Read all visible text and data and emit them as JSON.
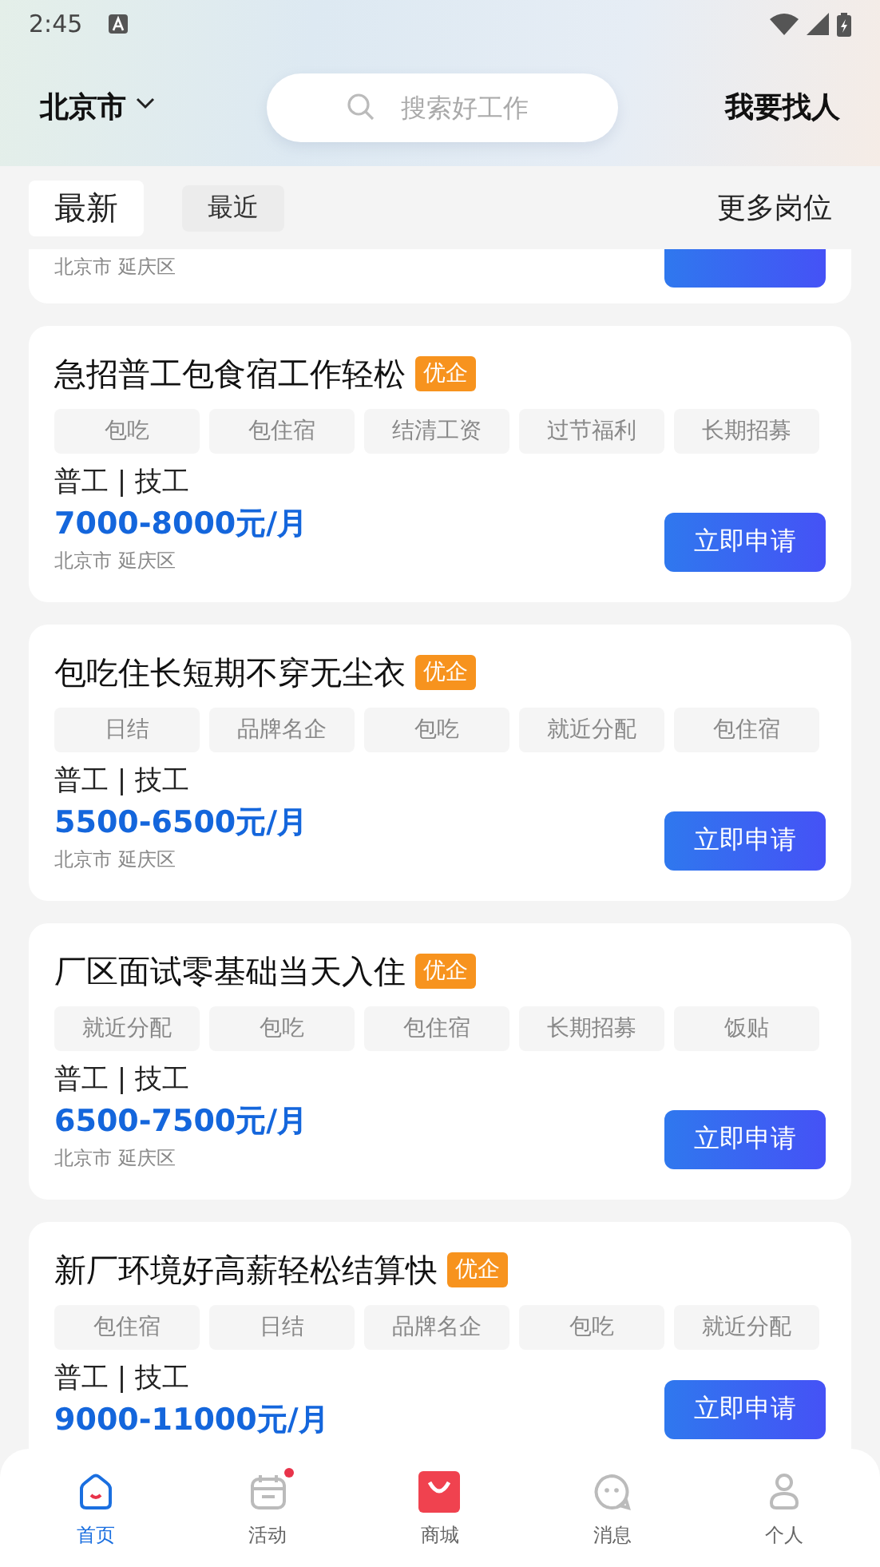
{
  "status_bar": {
    "time": "2:45"
  },
  "header": {
    "city": "北京市",
    "search": {
      "placeholder": "搜索好工作"
    },
    "action": "我要找人"
  },
  "tabs": [
    {
      "label": "最新",
      "selected": true
    },
    {
      "label": "最近",
      "selected": false
    }
  ],
  "more_link": "更多岗位",
  "partial_card": {
    "location": "北京市 延庆区"
  },
  "jobs": [
    {
      "title": "急招普工包食宿工作轻松",
      "badge": "优企",
      "tags": [
        "包吃",
        "包住宿",
        "结清工资",
        "过节福利",
        "长期招募"
      ],
      "category": "普工 | 技工",
      "salary": "7000-8000元/月",
      "location": "北京市 延庆区",
      "button": "立即申请"
    },
    {
      "title": "包吃住长短期不穿无尘衣",
      "badge": "优企",
      "tags": [
        "日结",
        "品牌名企",
        "包吃",
        "就近分配",
        "包住宿"
      ],
      "category": "普工 | 技工",
      "salary": "5500-6500元/月",
      "location": "北京市 延庆区",
      "button": "立即申请"
    },
    {
      "title": "厂区面试零基础当天入住",
      "badge": "优企",
      "tags": [
        "就近分配",
        "包吃",
        "包住宿",
        "长期招募",
        "饭贴"
      ],
      "category": "普工 | 技工",
      "salary": "6500-7500元/月",
      "location": "北京市 延庆区",
      "button": "立即申请"
    },
    {
      "title": "新厂环境好高薪轻松结算快",
      "badge": "优企",
      "tags": [
        "包住宿",
        "日结",
        "品牌名企",
        "包吃",
        "就近分配"
      ],
      "category": "普工 | 技工",
      "salary": "9000-11000元/月",
      "button": "立即申请"
    }
  ],
  "bottom_nav": [
    {
      "kind": "home",
      "label": "首页",
      "selected": true,
      "dot": false
    },
    {
      "kind": "calendar",
      "label": "活动",
      "selected": false,
      "dot": true
    },
    {
      "kind": "shop",
      "label": "商城",
      "selected": false,
      "dot": false
    },
    {
      "kind": "chat",
      "label": "消息",
      "selected": false,
      "dot": false
    },
    {
      "kind": "person",
      "label": "个人",
      "selected": false,
      "dot": false
    }
  ]
}
